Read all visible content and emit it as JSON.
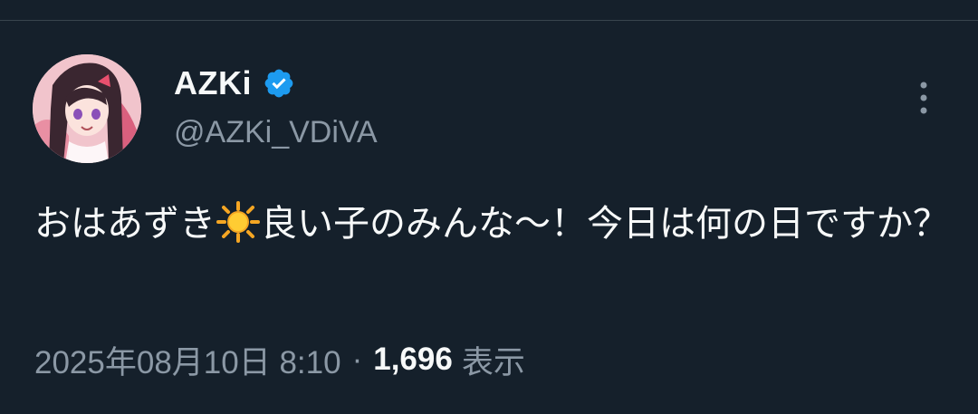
{
  "tweet": {
    "author": {
      "display_name": "AZKi",
      "handle": "@AZKi_VDiVA",
      "verified": true,
      "verified_color": "#1d9bf0"
    },
    "text_part1": "おはあずき",
    "emoji": "sun-emoji",
    "text_part2": "良い子のみんな〜！今日は何の日ですか？",
    "timestamp": "2025年08月10日 8:10",
    "separator": "·",
    "views_count": "1,696",
    "views_label": "表示"
  },
  "theme": {
    "background": "#15202b",
    "primary_text": "#f7f9f9",
    "secondary_text": "#8b98a5"
  }
}
